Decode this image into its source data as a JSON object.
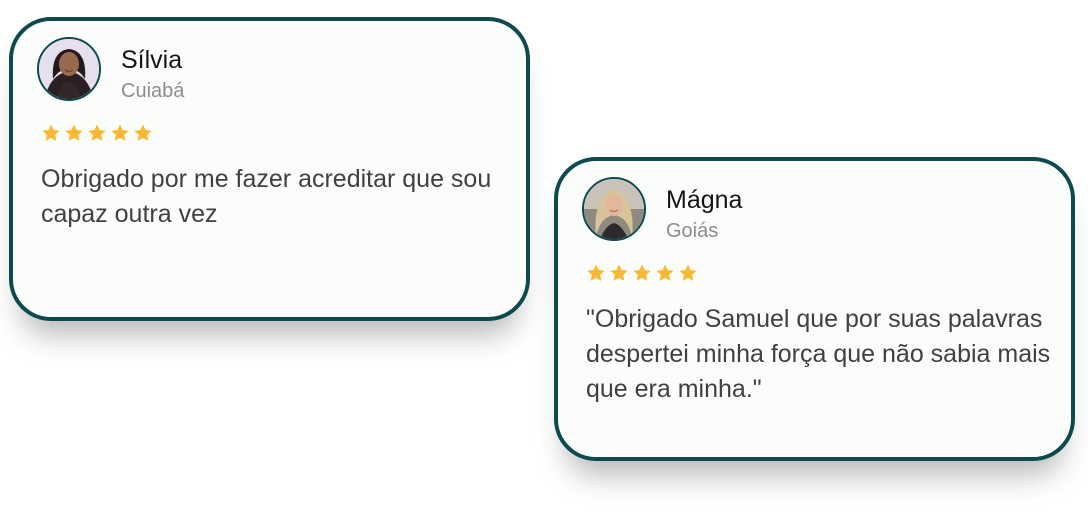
{
  "testimonials": [
    {
      "name": "Sílvia",
      "city": "Cuiabá",
      "rating": 5,
      "quote": "Obrigado por me fazer acreditar que sou capaz outra vez",
      "avatar_icon": "woman-portrait-avatar"
    },
    {
      "name": "Mágna",
      "city": "Goiás",
      "rating": 5,
      "quote": "\"Obrigado Samuel que por suas palavras despertei minha força que não sabia mais que era minha.\"",
      "avatar_icon": "woman-portrait-avatar"
    }
  ],
  "colors": {
    "card_border": "#0d4a4d",
    "card_background": "#fbfdfb",
    "star": "#f9b935",
    "name_text": "#151515",
    "city_text": "#8c8c8c",
    "quote_text": "#404040"
  }
}
